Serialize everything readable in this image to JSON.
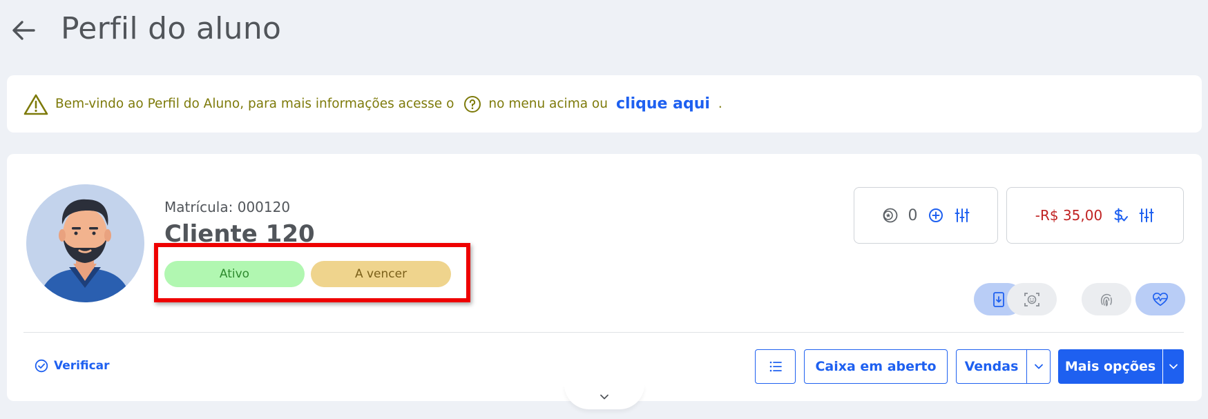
{
  "header": {
    "title": "Perfil do aluno"
  },
  "info_banner": {
    "text_before": "Bem-vindo ao Perfil do Aluno, para mais informações acesse o",
    "text_after": "no menu acima ou",
    "link_label": "clique aqui",
    "trailing": "."
  },
  "profile": {
    "matricula": "Matrícula: 000120",
    "name": "Cliente 120",
    "badges": [
      {
        "label": "Ativo",
        "color": "#b1f7b1"
      },
      {
        "label": "A vencer",
        "color": "#efd48d"
      }
    ]
  },
  "stats": {
    "points": "0",
    "balance": "-R$ 35,00"
  },
  "actions": {
    "verify_label": "Verificar",
    "caixa_label": "Caixa em aberto",
    "vendas_label": "Vendas",
    "mais_label": "Mais opções"
  },
  "colors": {
    "accent": "#1e60f0",
    "warning_text": "#7d7a0a",
    "negative_balance": "#c02222",
    "highlight": "#ee0000"
  }
}
